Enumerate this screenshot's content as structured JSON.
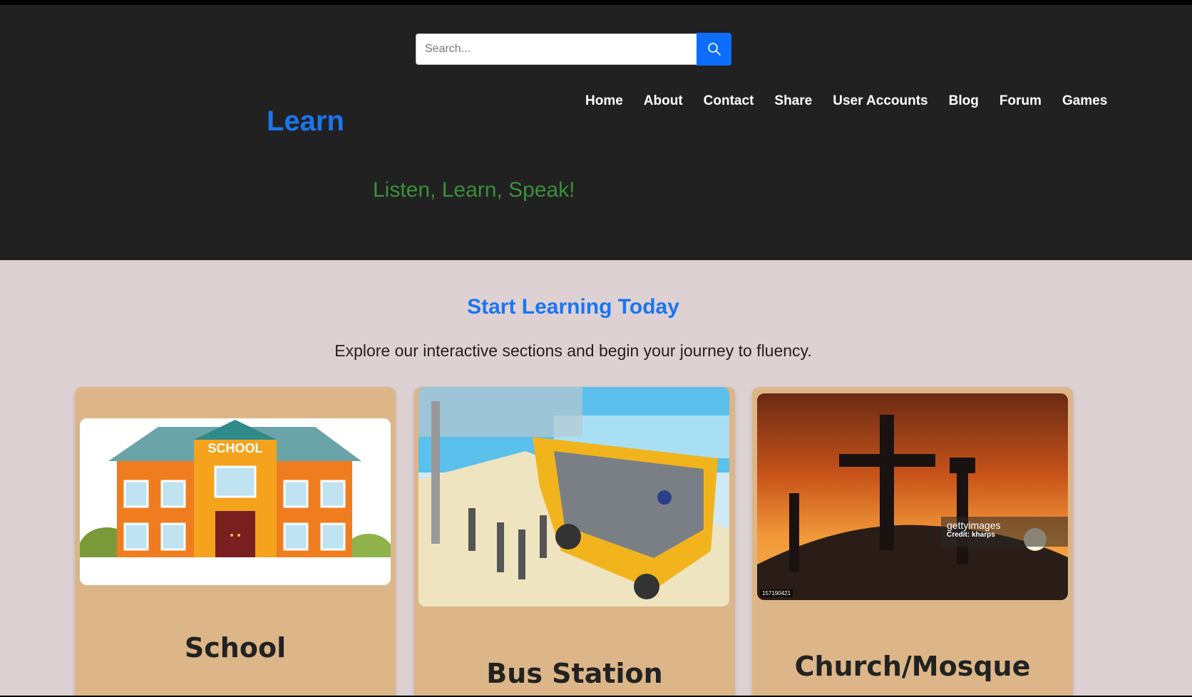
{
  "search": {
    "placeholder": "Search...",
    "button_icon": "search-icon"
  },
  "brand": "Learn",
  "nav": [
    "Home",
    "About",
    "Contact",
    "Share",
    "User Accounts",
    "Blog",
    "Forum",
    "Games"
  ],
  "tagline": "Listen, Learn, Speak!",
  "main": {
    "title": "Start Learning Today",
    "subtitle": "Explore our interactive sections and begin your journey to fluency."
  },
  "cards": [
    {
      "title": "School",
      "image_text": "SCHOOL"
    },
    {
      "title": "Bus Station"
    },
    {
      "title": "Church/Mosque",
      "watermark": "gettyimages",
      "credit": "Credit: kharps",
      "image_id": "157190421"
    }
  ],
  "colors": {
    "header_bg": "#212121",
    "brand": "#1a75f0",
    "tagline": "#3a8f3a",
    "page_bg": "#ddd1d3",
    "card_bg": "#dcb688",
    "button": "#0d6efd"
  }
}
